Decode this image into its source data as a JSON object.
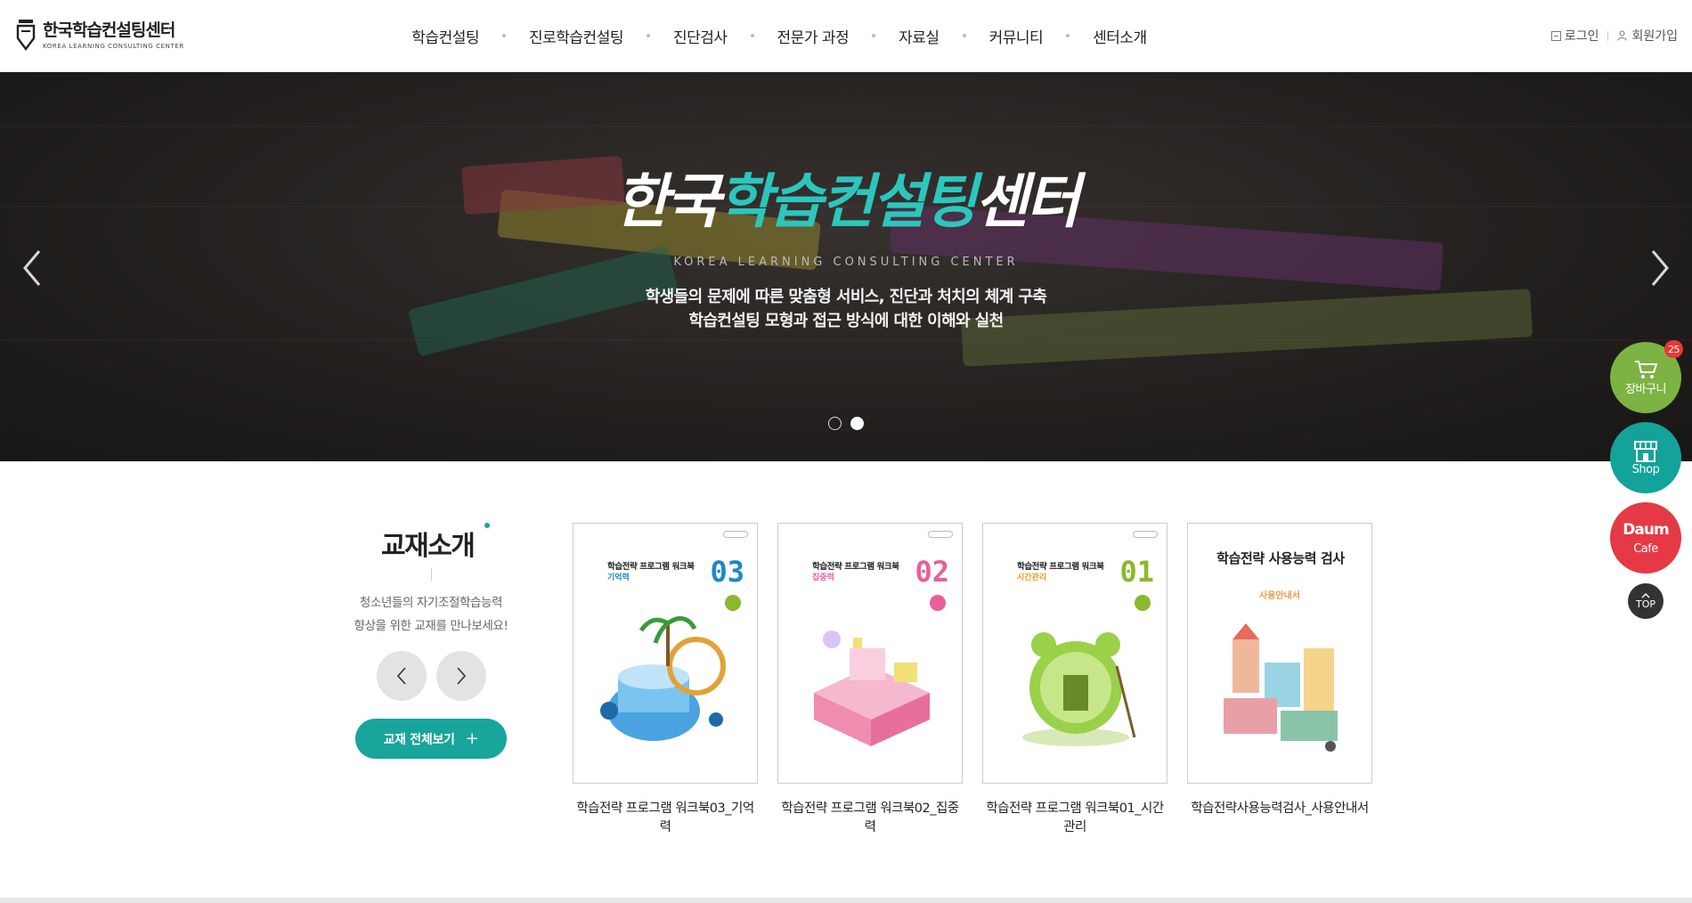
{
  "header": {
    "logo_ko": "한국학습컨설팅센터",
    "logo_en": "KOREA LEARNING CONSULTING CENTER",
    "nav": [
      "학습컨설팅",
      "진로학습컨설팅",
      "진단검사",
      "전문가 과정",
      "자료실",
      "커뮤니티",
      "센터소개"
    ],
    "login": "로그인",
    "join": "회원가입"
  },
  "hero": {
    "title_white_1": "한국",
    "title_teal": "학습컨설팅",
    "title_white_2": "센터",
    "subtitle_en": "KOREA LEARNING CONSULTING CENTER",
    "line1": "학생들의 문제에 따른 맞춤형 서비스, 진단과 처치의 체계 구축",
    "line2": "학습컨설팅 모형과 접근 방식에 대한 이해와 실천",
    "slides_total": 2,
    "slide_active": 2
  },
  "books_section": {
    "title": "교재소개",
    "desc_line1": "청소년들의 자기조절학습능력",
    "desc_line2": "향상을 위한 교재를 만나보세요!",
    "view_all": "교재 전체보기",
    "plus": "+",
    "books": [
      {
        "name": "학습전략 프로그램 워크북03_기억력",
        "cover_title": "학습전략 프로그램 워크북",
        "cover_sub": "기억력",
        "cover_num": "03",
        "accent": "#1e88c8"
      },
      {
        "name": "학습전략 프로그램 워크북02_집중력",
        "cover_title": "학습전략 프로그램 워크북",
        "cover_sub": "집중력",
        "cover_num": "02",
        "accent": "#e8609a"
      },
      {
        "name": "학습전략 프로그램 워크북01_시간관리",
        "cover_title": "학습전략 프로그램 워크북",
        "cover_sub": "시간관리",
        "cover_num": "01",
        "accent": "#8ab82e"
      },
      {
        "name": "학습전략사용능력검사_사용안내서",
        "cover_title": "학습전략 사용능력 검사",
        "cover_sub": "사용안내서",
        "cover_num": "",
        "accent": "#e89a4a"
      }
    ]
  },
  "quick_menu": {
    "cart_label": "장바구니",
    "cart_count": "25",
    "shop_label": "Shop",
    "cafe_logo": "Daum",
    "cafe_label": "Cafe",
    "top_label": "TOP"
  },
  "colors": {
    "teal": "#18a59b",
    "cart_green": "#7cb342",
    "shop_teal": "#14a39a",
    "cafe_red": "#e53a45"
  }
}
